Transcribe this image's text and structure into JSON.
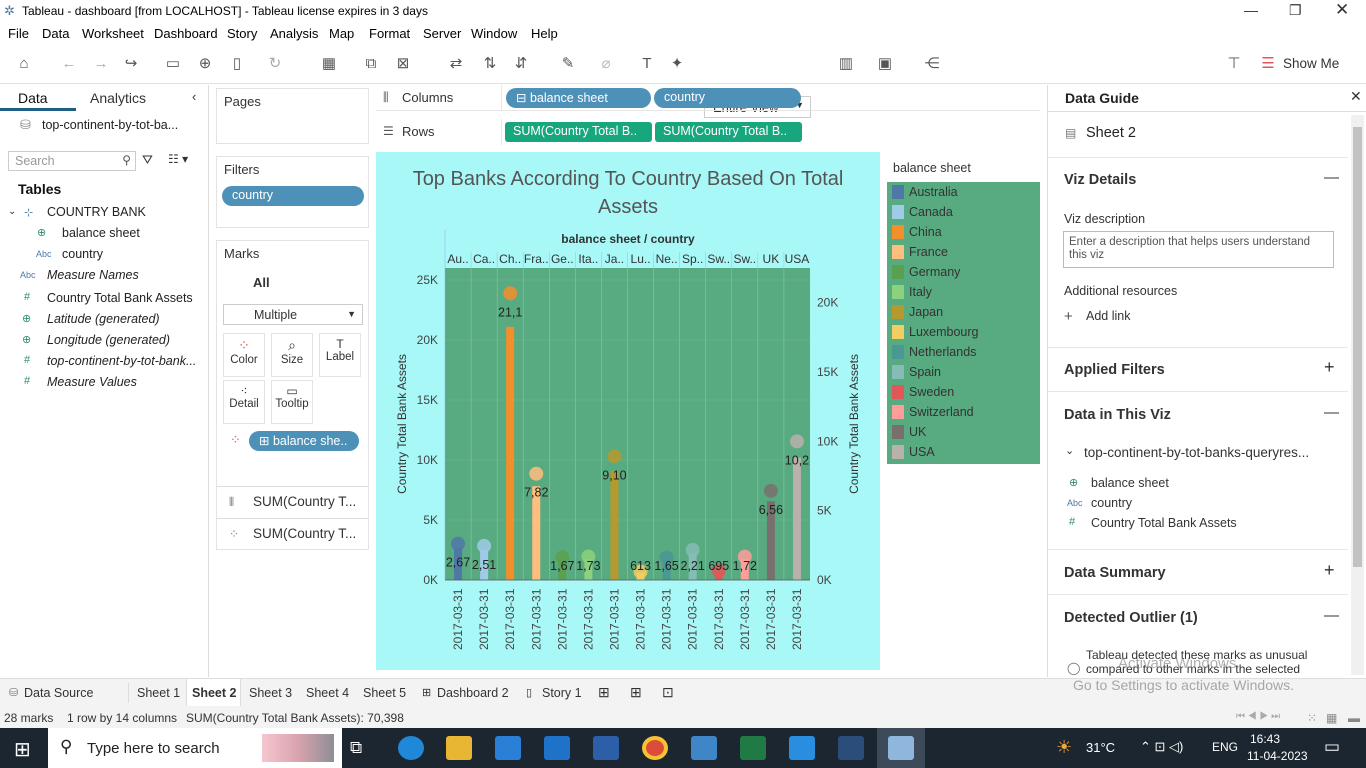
{
  "window": {
    "title": "Tableau - dashboard [from LOCALHOST] - Tableau license expires in 3 days"
  },
  "menu": [
    "File",
    "Data",
    "Worksheet",
    "Dashboard",
    "Story",
    "Analysis",
    "Map",
    "Format",
    "Server",
    "Window",
    "Help"
  ],
  "toolbar": {
    "view_select": "Entire View",
    "show_me": "Show Me"
  },
  "data_pane": {
    "tab_data": "Data",
    "tab_analytics": "Analytics",
    "datasource": "top-continent-by-tot-ba...",
    "search_placeholder": "Search",
    "tables_heading": "Tables",
    "fields": [
      {
        "label": "COUNTRY BANK",
        "icon": "table-icon"
      },
      {
        "label": "balance sheet",
        "icon": "globe-icon"
      },
      {
        "label": "country",
        "icon": "abc-icon"
      },
      {
        "label": "Measure Names",
        "icon": "abc-icon"
      },
      {
        "label": "Country Total Bank Assets",
        "icon": "hash-icon"
      },
      {
        "label": "Latitude (generated)",
        "icon": "globe-icon"
      },
      {
        "label": "Longitude (generated)",
        "icon": "globe-icon"
      },
      {
        "label": "top-continent-by-tot-bank...",
        "icon": "hash-icon"
      },
      {
        "label": "Measure Values",
        "icon": "hash-icon"
      }
    ]
  },
  "shelves": {
    "pages": "Pages",
    "filters": "Filters",
    "filter_pill": "country",
    "marks": "Marks",
    "marks_all": "All",
    "mark_type": "Multiple",
    "mark_buttons": [
      "Color",
      "Size",
      "Label",
      "Detail",
      "Tooltip"
    ],
    "marks_pill": "balance she..",
    "sum1": "SUM(Country T...",
    "sum2": "SUM(Country T...",
    "columns_label": "Columns",
    "rows_label": "Rows",
    "col_pill1": "balance sheet",
    "col_pill2": "country",
    "row_pill1": "SUM(Country Total B..",
    "row_pill2": "SUM(Country Total B.."
  },
  "chart_data": {
    "type": "bar",
    "title": "Top Banks According To Country Based On Total Assets",
    "header": "balance sheet / country",
    "categories": [
      "Au..",
      "Ca..",
      "Ch..",
      "Fra..",
      "Ge..",
      "Ita..",
      "Ja..",
      "Lu..",
      "Ne..",
      "Sp..",
      "Sw..",
      "Sw..",
      "UK",
      "USA"
    ],
    "x_labels": [
      "2017-03-31",
      "2017-03-31",
      "2017-03-31",
      "2017-03-31",
      "2017-03-31",
      "2017-03-31",
      "2017-03-31",
      "2017-03-31",
      "2017-03-31",
      "2017-03-31",
      "2017-03-31",
      "2017-03-31",
      "2017-03-31",
      "2017-03-31"
    ],
    "values": [
      2670,
      2510,
      21100,
      7820,
      1670,
      1730,
      9100,
      613,
      1650,
      2210,
      695,
      1720,
      6560,
      10200
    ],
    "data_labels": [
      "2,67",
      "2,51",
      "21,1",
      "7,82",
      "1,67",
      "1,73",
      "9,10",
      "613",
      "1,65",
      "2,21",
      "695",
      "1,72",
      "6,56",
      "10,2"
    ],
    "colors": [
      "#4e79a7",
      "#a0cbe8",
      "#f28e2b",
      "#ffbe7d",
      "#59a14f",
      "#8cd17d",
      "#b6992d",
      "#f1ce63",
      "#499894",
      "#86bcb6",
      "#e15759",
      "#ff9d9a",
      "#79706e",
      "#bab0ac"
    ],
    "ylabel": "Country Total Bank Assets",
    "ylabel_right": "Country Total Bank Assets",
    "y_ticks": [
      "25K",
      "20K",
      "15K",
      "10K",
      "5K",
      "0K"
    ],
    "y_ticks_right": [
      "20K",
      "15K",
      "10K",
      "5K",
      "0K"
    ],
    "ylim": [
      0,
      26000
    ]
  },
  "legend": {
    "title": "balance sheet",
    "items": [
      "Australia",
      "Canada",
      "China",
      "France",
      "Germany",
      "Italy",
      "Japan",
      "Luxembourg",
      "Netherlands",
      "Spain",
      "Sweden",
      "Switzerland",
      "UK",
      "USA"
    ]
  },
  "guide": {
    "title": "Data Guide",
    "sheet": "Sheet 2",
    "viz_details": "Viz Details",
    "viz_description": "Viz description",
    "desc_placeholder": "Enter a description that helps users understand this viz",
    "additional": "Additional resources",
    "add_link": "Add link",
    "applied_filters": "Applied Filters",
    "data_in_viz": "Data in This Viz",
    "source": "top-continent-by-tot-banks-queryres...",
    "f1": "balance sheet",
    "f2": "country",
    "f3": "Country Total Bank Assets",
    "data_summary": "Data Summary",
    "outlier": "Detected Outlier (1)",
    "outlier_text": "Tableau detected these marks as unusual compared to other marks in the selected",
    "watermark1": "Activate Windows",
    "watermark2": "Go to Settings to activate Windows."
  },
  "sheets": [
    "Data Source",
    "Sheet 1",
    "Sheet 2",
    "Sheet 3",
    "Sheet 4",
    "Sheet 5",
    "Dashboard 2",
    "Story 1"
  ],
  "status": {
    "marks": "28 marks",
    "rows": "1 row by 14 columns",
    "sum": "SUM(Country Total Bank Assets): 70,398"
  },
  "taskbar": {
    "search": "Type here to search",
    "temp": "31°C",
    "lang": "ENG",
    "time": "16:43",
    "date": "11-04-2023"
  }
}
